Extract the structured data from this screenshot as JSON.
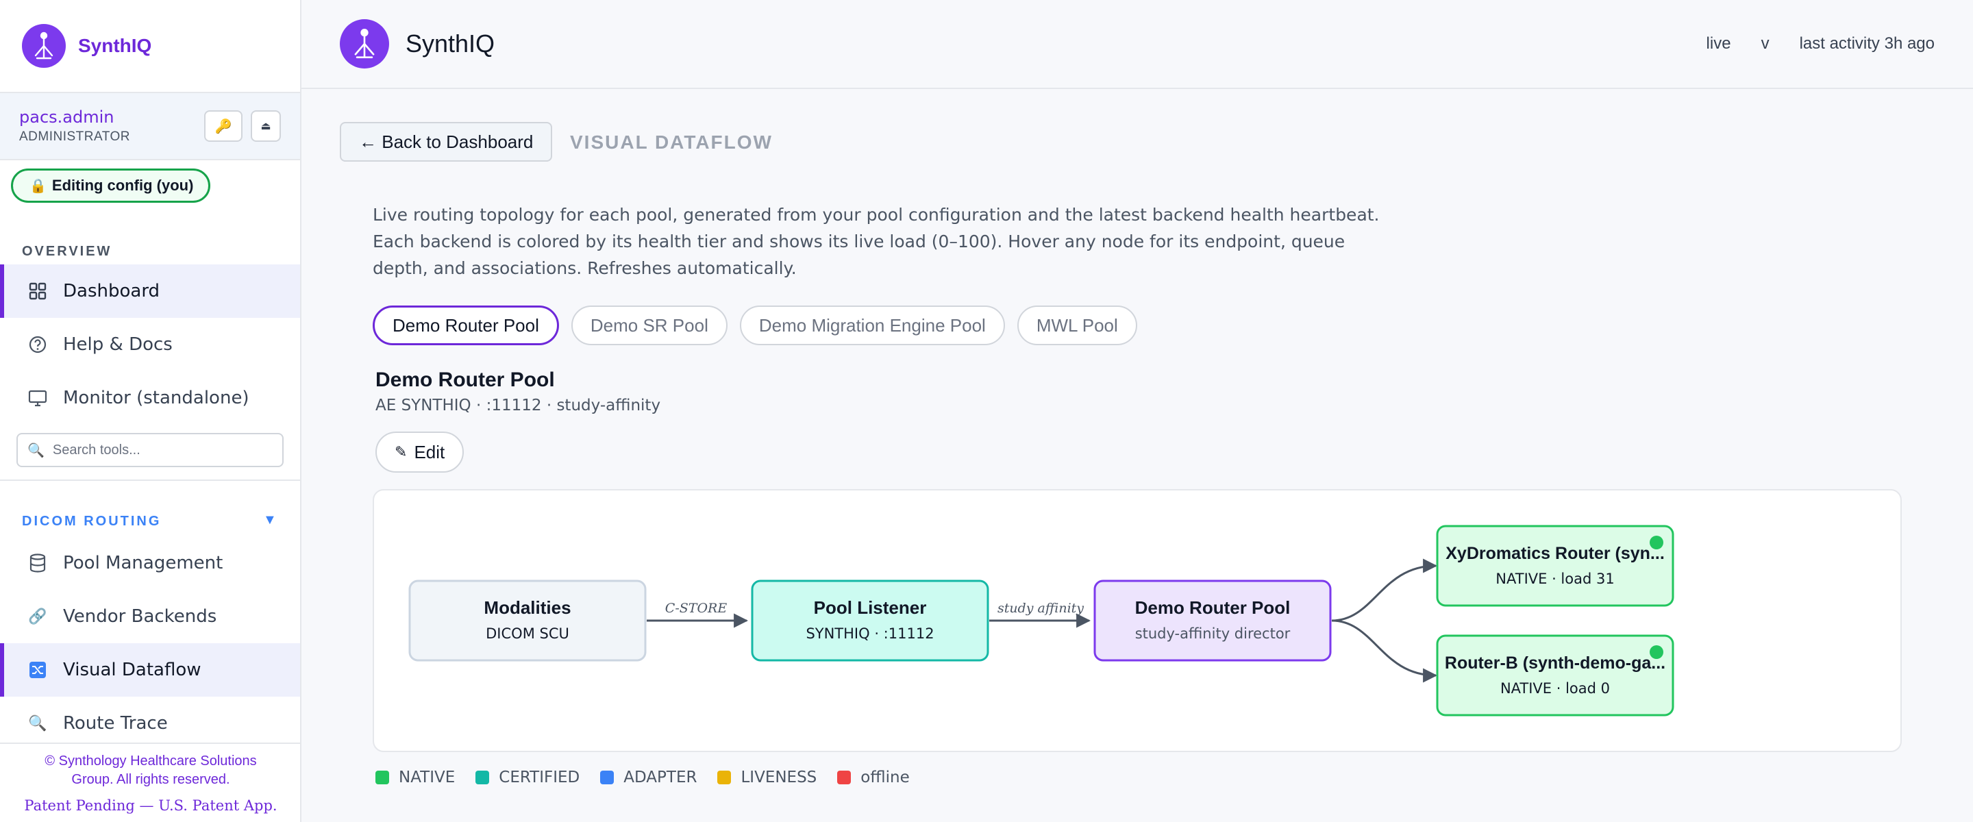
{
  "app": {
    "name": "SynthIQ"
  },
  "user": {
    "name": "pacs.admin",
    "role": "ADMINISTRATOR"
  },
  "editing_badge": "Editing config (you)",
  "sidebar": {
    "overview_label": "OVERVIEW",
    "overview_items": [
      {
        "label": "Dashboard",
        "icon": "grid-icon",
        "active": true
      },
      {
        "label": "Help & Docs",
        "icon": "help-icon",
        "active": false
      },
      {
        "label": "Monitor (standalone)",
        "icon": "monitor-icon",
        "active": false
      }
    ],
    "search_placeholder": "Search tools...",
    "routing_label": "DICOM ROUTING",
    "routing_items": [
      {
        "label": "Pool Management",
        "icon": "database-icon",
        "active": false
      },
      {
        "label": "Vendor Backends",
        "icon": "link-icon",
        "active": false
      },
      {
        "label": "Visual Dataflow",
        "icon": "shuffle-icon",
        "active": true
      },
      {
        "label": "Route Trace",
        "icon": "magnifier-icon",
        "active": false
      }
    ],
    "footer_copyright": "© Synthology Healthcare Solutions Group. All rights reserved.",
    "footer_patent": "Patent Pending — U.S. Patent App."
  },
  "header": {
    "title": "SynthIQ",
    "status_live": "live",
    "status_v": "v",
    "last_activity": "last activity 3h ago"
  },
  "main": {
    "back_label": "← Back to Dashboard",
    "view_title": "VISUAL DATAFLOW",
    "description": "Live routing topology for each pool, generated from your pool configuration and the latest backend health heartbeat. Each backend is colored by its health tier and shows its live load (0–100). Hover any node for its endpoint, queue depth, and associations. Refreshes automatically.",
    "tabs": [
      {
        "label": "Demo Router Pool",
        "active": true
      },
      {
        "label": "Demo SR Pool",
        "active": false
      },
      {
        "label": "Demo Migration Engine Pool",
        "active": false
      },
      {
        "label": "MWL Pool",
        "active": false
      }
    ],
    "pool_title": "Demo Router Pool",
    "pool_meta": "AE SYNTHIQ · :11112 · study-affinity",
    "edit_label": "Edit"
  },
  "flow": {
    "nodes": {
      "modalities": {
        "title": "Modalities",
        "sub": "DICOM SCU"
      },
      "listener": {
        "title": "Pool Listener",
        "sub": "SYNTHIQ · :11112"
      },
      "director": {
        "title": "Demo Router Pool",
        "sub": "study-affinity director"
      },
      "backend1": {
        "title": "XyDromatics Router (syn...",
        "sub": "NATIVE · load 31"
      },
      "backend2": {
        "title": "Router-B (synth-demo-ga...",
        "sub": "NATIVE · load 0"
      }
    },
    "edges": {
      "e1": "C-STORE",
      "e2": "study affinity"
    }
  },
  "legend": [
    {
      "label": "NATIVE",
      "color": "#22c55e"
    },
    {
      "label": "CERTIFIED",
      "color": "#14b8a6"
    },
    {
      "label": "ADAPTER",
      "color": "#3b82f6"
    },
    {
      "label": "LIVENESS",
      "color": "#eab308"
    },
    {
      "label": "offline",
      "color": "#ef4444"
    }
  ],
  "colors": {
    "brand": "#6d28d9",
    "accent_green": "#16a34a"
  }
}
